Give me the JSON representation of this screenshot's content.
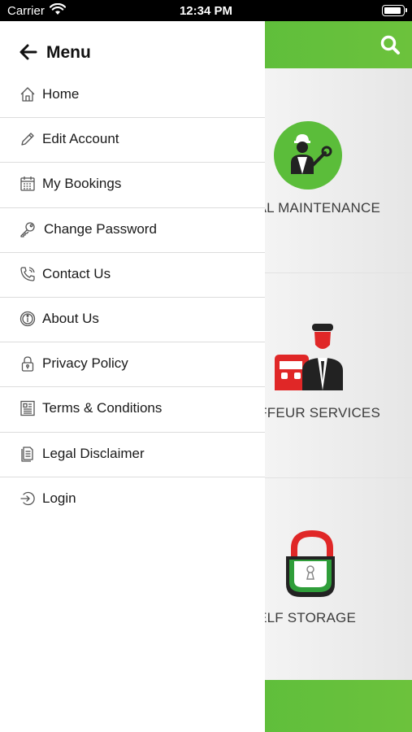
{
  "status_bar": {
    "carrier": "Carrier",
    "time": "12:34 PM"
  },
  "drawer": {
    "title": "Menu",
    "items": [
      {
        "label": "Home",
        "icon": "home-icon"
      },
      {
        "label": "Edit Account",
        "icon": "pencil-icon"
      },
      {
        "label": "My Bookings",
        "icon": "calendar-icon"
      },
      {
        "label": "Change Password",
        "icon": "key-icon"
      },
      {
        "label": "Contact Us",
        "icon": "phone-icon"
      },
      {
        "label": "About Us",
        "icon": "info-icon"
      },
      {
        "label": "Privacy Policy",
        "icon": "lock-icon"
      },
      {
        "label": "Terms & Conditions",
        "icon": "document-icon"
      },
      {
        "label": "Legal Disclaimer",
        "icon": "file-icon"
      },
      {
        "label": "Login",
        "icon": "login-icon"
      }
    ]
  },
  "background": {
    "tiles": [
      {
        "label": "AL MAINTENANCE",
        "icon": "mechanic-icon"
      },
      {
        "label": "UFFEUR SERVICES",
        "icon": "chauffeur-icon"
      },
      {
        "label": "SELF STORAGE",
        "icon": "padlock-icon"
      }
    ]
  },
  "colors": {
    "brand_green": "#5bbd3a",
    "chauffeur_red": "#e02727"
  }
}
